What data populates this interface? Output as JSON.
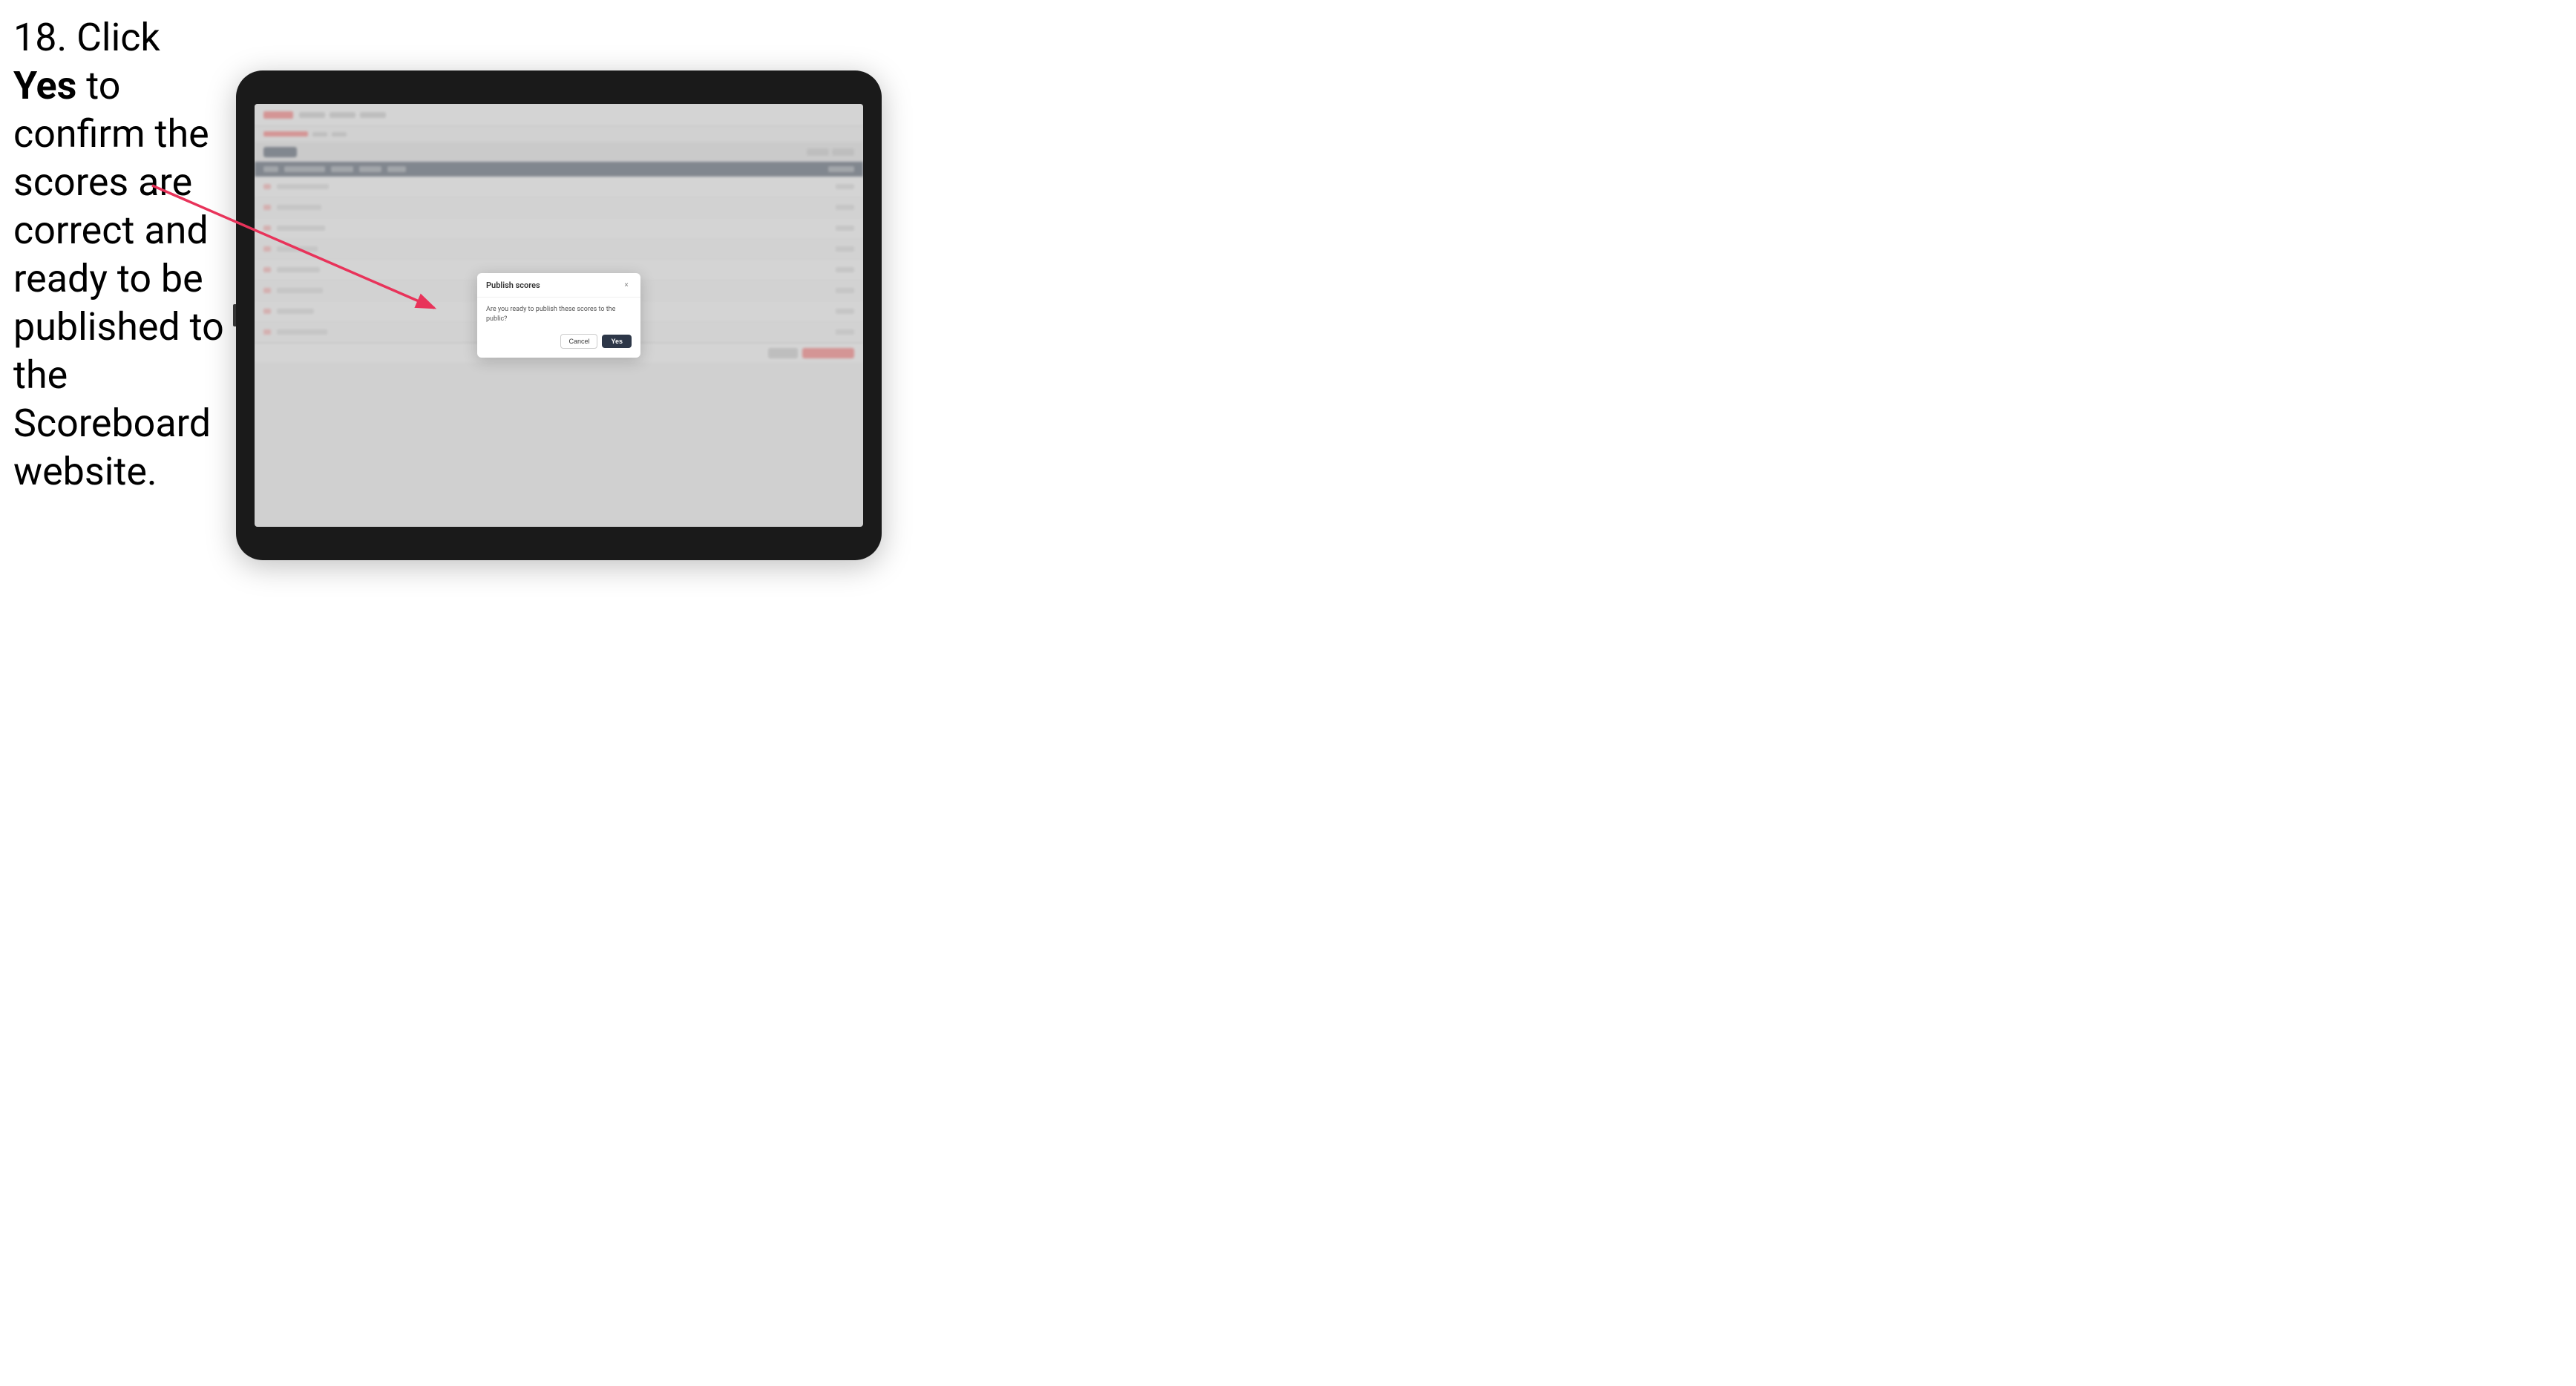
{
  "instruction": {
    "step": "18.",
    "text_part1": " Click ",
    "bold": "Yes",
    "text_part2": " to confirm the scores are correct and ready to be published to the Scoreboard website."
  },
  "modal": {
    "title": "Publish scores",
    "message": "Are you ready to publish these scores to the public?",
    "cancel_label": "Cancel",
    "yes_label": "Yes",
    "close_icon": "×"
  },
  "arrow": {
    "description": "arrow pointing to modal dialog"
  }
}
